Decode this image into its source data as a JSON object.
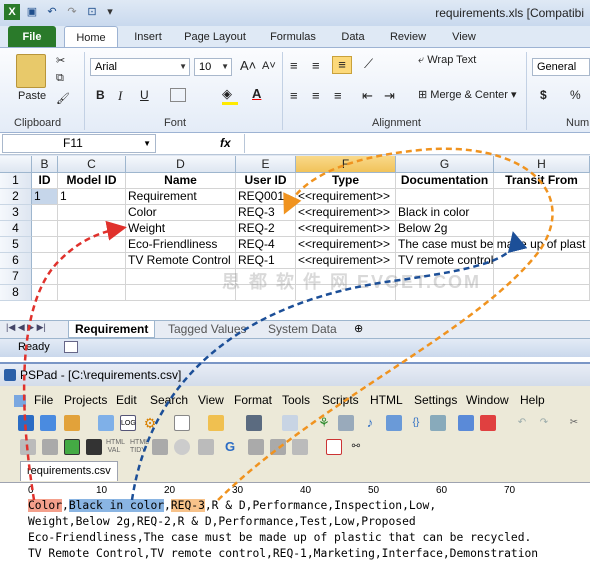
{
  "excel": {
    "title": "requirements.xls  [Compatibi",
    "tabs": [
      "File",
      "Home",
      "Insert",
      "Page Layout",
      "Formulas",
      "Data",
      "Review",
      "View"
    ],
    "ribbon": {
      "paste_label": "Paste",
      "font_name": "Arial",
      "font_size": "10",
      "grow_font": "A˄",
      "shrink_font": "A˅",
      "bold": "B",
      "italic": "I",
      "underline": "U",
      "wrap_text": "Wrap Text",
      "merge_center": "Merge & Center",
      "number_format": "General",
      "currency": "$",
      "percent": "%",
      "groups": {
        "clipboard": "Clipboard",
        "font": "Font",
        "alignment": "Alignment",
        "number": "Num"
      }
    },
    "name_box": "F11",
    "fx_label": "fx",
    "columns": [
      "B",
      "C",
      "D",
      "E",
      "F",
      "G",
      "H"
    ],
    "rows": [
      "1",
      "2",
      "3",
      "4",
      "5",
      "6",
      "7",
      "8"
    ],
    "headers": [
      "ID",
      "Model ID",
      "Name",
      "User ID",
      "Type",
      "Documentation",
      "Transit From"
    ],
    "data": [
      [
        "1",
        "1",
        "Requirement",
        "REQ001",
        "<<requirement>>",
        "",
        ""
      ],
      [
        "",
        "",
        "Color",
        "REQ-3",
        "<<requirement>>",
        "Black in color",
        ""
      ],
      [
        "",
        "",
        "Weight",
        "REQ-2",
        "<<requirement>>",
        "Below 2g",
        ""
      ],
      [
        "",
        "",
        "Eco-Friendliness",
        "REQ-4",
        "<<requirement>>",
        "The case must be made up of plast",
        ""
      ],
      [
        "",
        "",
        "TV Remote Control",
        "REQ-1",
        "<<requirement>>",
        "TV remote control",
        ""
      ]
    ],
    "sheet_tabs": [
      "Requirement",
      "Tagged Values",
      "System Data"
    ],
    "status": "Ready",
    "watermark": "思  都  软  件  网   EVGET.COM"
  },
  "pspad": {
    "title": "PSPad - [C:\\requirements.csv]",
    "menu": [
      "File",
      "Projects",
      "Edit",
      "Search",
      "View",
      "Format",
      "Tools",
      "Scripts",
      "HTML",
      "Settings",
      "Window",
      "Help"
    ],
    "file_tab": "requirements.csv",
    "ruler": [
      "0",
      "10",
      "20",
      "30",
      "40",
      "50",
      "60",
      "70"
    ],
    "lines": {
      "l1_a": "Color",
      "l1_b": "Black in color",
      "l1_c": "REQ-3",
      "l1_rest": ",R & D,Performance,Inspection,Low,",
      "l2": "Weight,Below 2g,REQ-2,R & D,Performance,Test,Low,Proposed",
      "l3": "Eco-Friendliness,The case must be made up of plastic that can be recycled.",
      "l4": "TV Remote Control,TV remote control,REQ-1,Marketing,Interface,Demonstration"
    }
  },
  "colors": {
    "red": "#e0312c",
    "blue": "#1c4f98",
    "orange": "#f0931f",
    "file_tab": "#2a7a2a"
  }
}
